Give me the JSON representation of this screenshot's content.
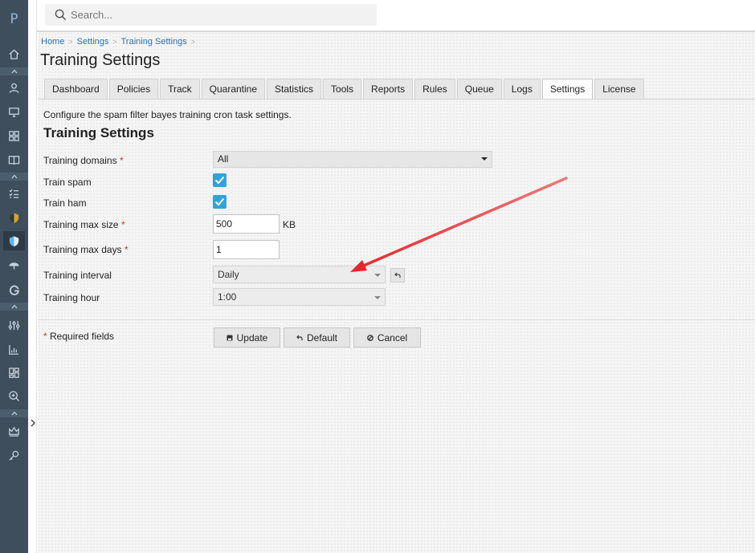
{
  "app": {
    "logo_letter": "P"
  },
  "search": {
    "placeholder": "Search..."
  },
  "breadcrumb": [
    "Home",
    "Settings",
    "Training Settings"
  ],
  "page": {
    "title": "Training Settings"
  },
  "tabs": [
    {
      "label": "Dashboard",
      "active": false
    },
    {
      "label": "Policies",
      "active": false
    },
    {
      "label": "Track",
      "active": false
    },
    {
      "label": "Quarantine",
      "active": false
    },
    {
      "label": "Statistics",
      "active": false
    },
    {
      "label": "Tools",
      "active": false
    },
    {
      "label": "Reports",
      "active": false
    },
    {
      "label": "Rules",
      "active": false
    },
    {
      "label": "Queue",
      "active": false
    },
    {
      "label": "Logs",
      "active": false
    },
    {
      "label": "Settings",
      "active": true
    },
    {
      "label": "License",
      "active": false
    }
  ],
  "content": {
    "description": "Configure the spam filter bayes training cron task settings.",
    "section_title": "Training Settings"
  },
  "form": {
    "training_domains": {
      "label": "Training domains",
      "value": "All"
    },
    "train_spam": {
      "label": "Train spam",
      "checked": true
    },
    "train_ham": {
      "label": "Train ham",
      "checked": true
    },
    "training_max_size": {
      "label": "Training max size",
      "value": "500",
      "unit": "KB"
    },
    "training_max_days": {
      "label": "Training max days",
      "value": "1"
    },
    "training_interval": {
      "label": "Training interval",
      "value": "Daily"
    },
    "training_hour": {
      "label": "Training hour",
      "value": "1:00"
    },
    "required_star": "*",
    "required_note": "Required fields"
  },
  "buttons": {
    "update": "Update",
    "default": "Default",
    "cancel": "Cancel"
  },
  "colors": {
    "sidebar": "#3e4e5c",
    "accent": "#2fa4d9",
    "link": "#2a73b5",
    "required": "#c0392b",
    "annotation_arrow": "#e8262b"
  },
  "sidebar_icons": [
    "home-icon",
    "user-icon",
    "monitor-icon",
    "grid-icon",
    "book-icon",
    "checklist-icon",
    "shield-badge-icon",
    "shield-active-icon",
    "umbrella-icon",
    "google-icon",
    "sliders-icon",
    "bar-chart-icon",
    "dashboard-icon",
    "search-zoom-icon",
    "crown-icon",
    "key-icon"
  ]
}
